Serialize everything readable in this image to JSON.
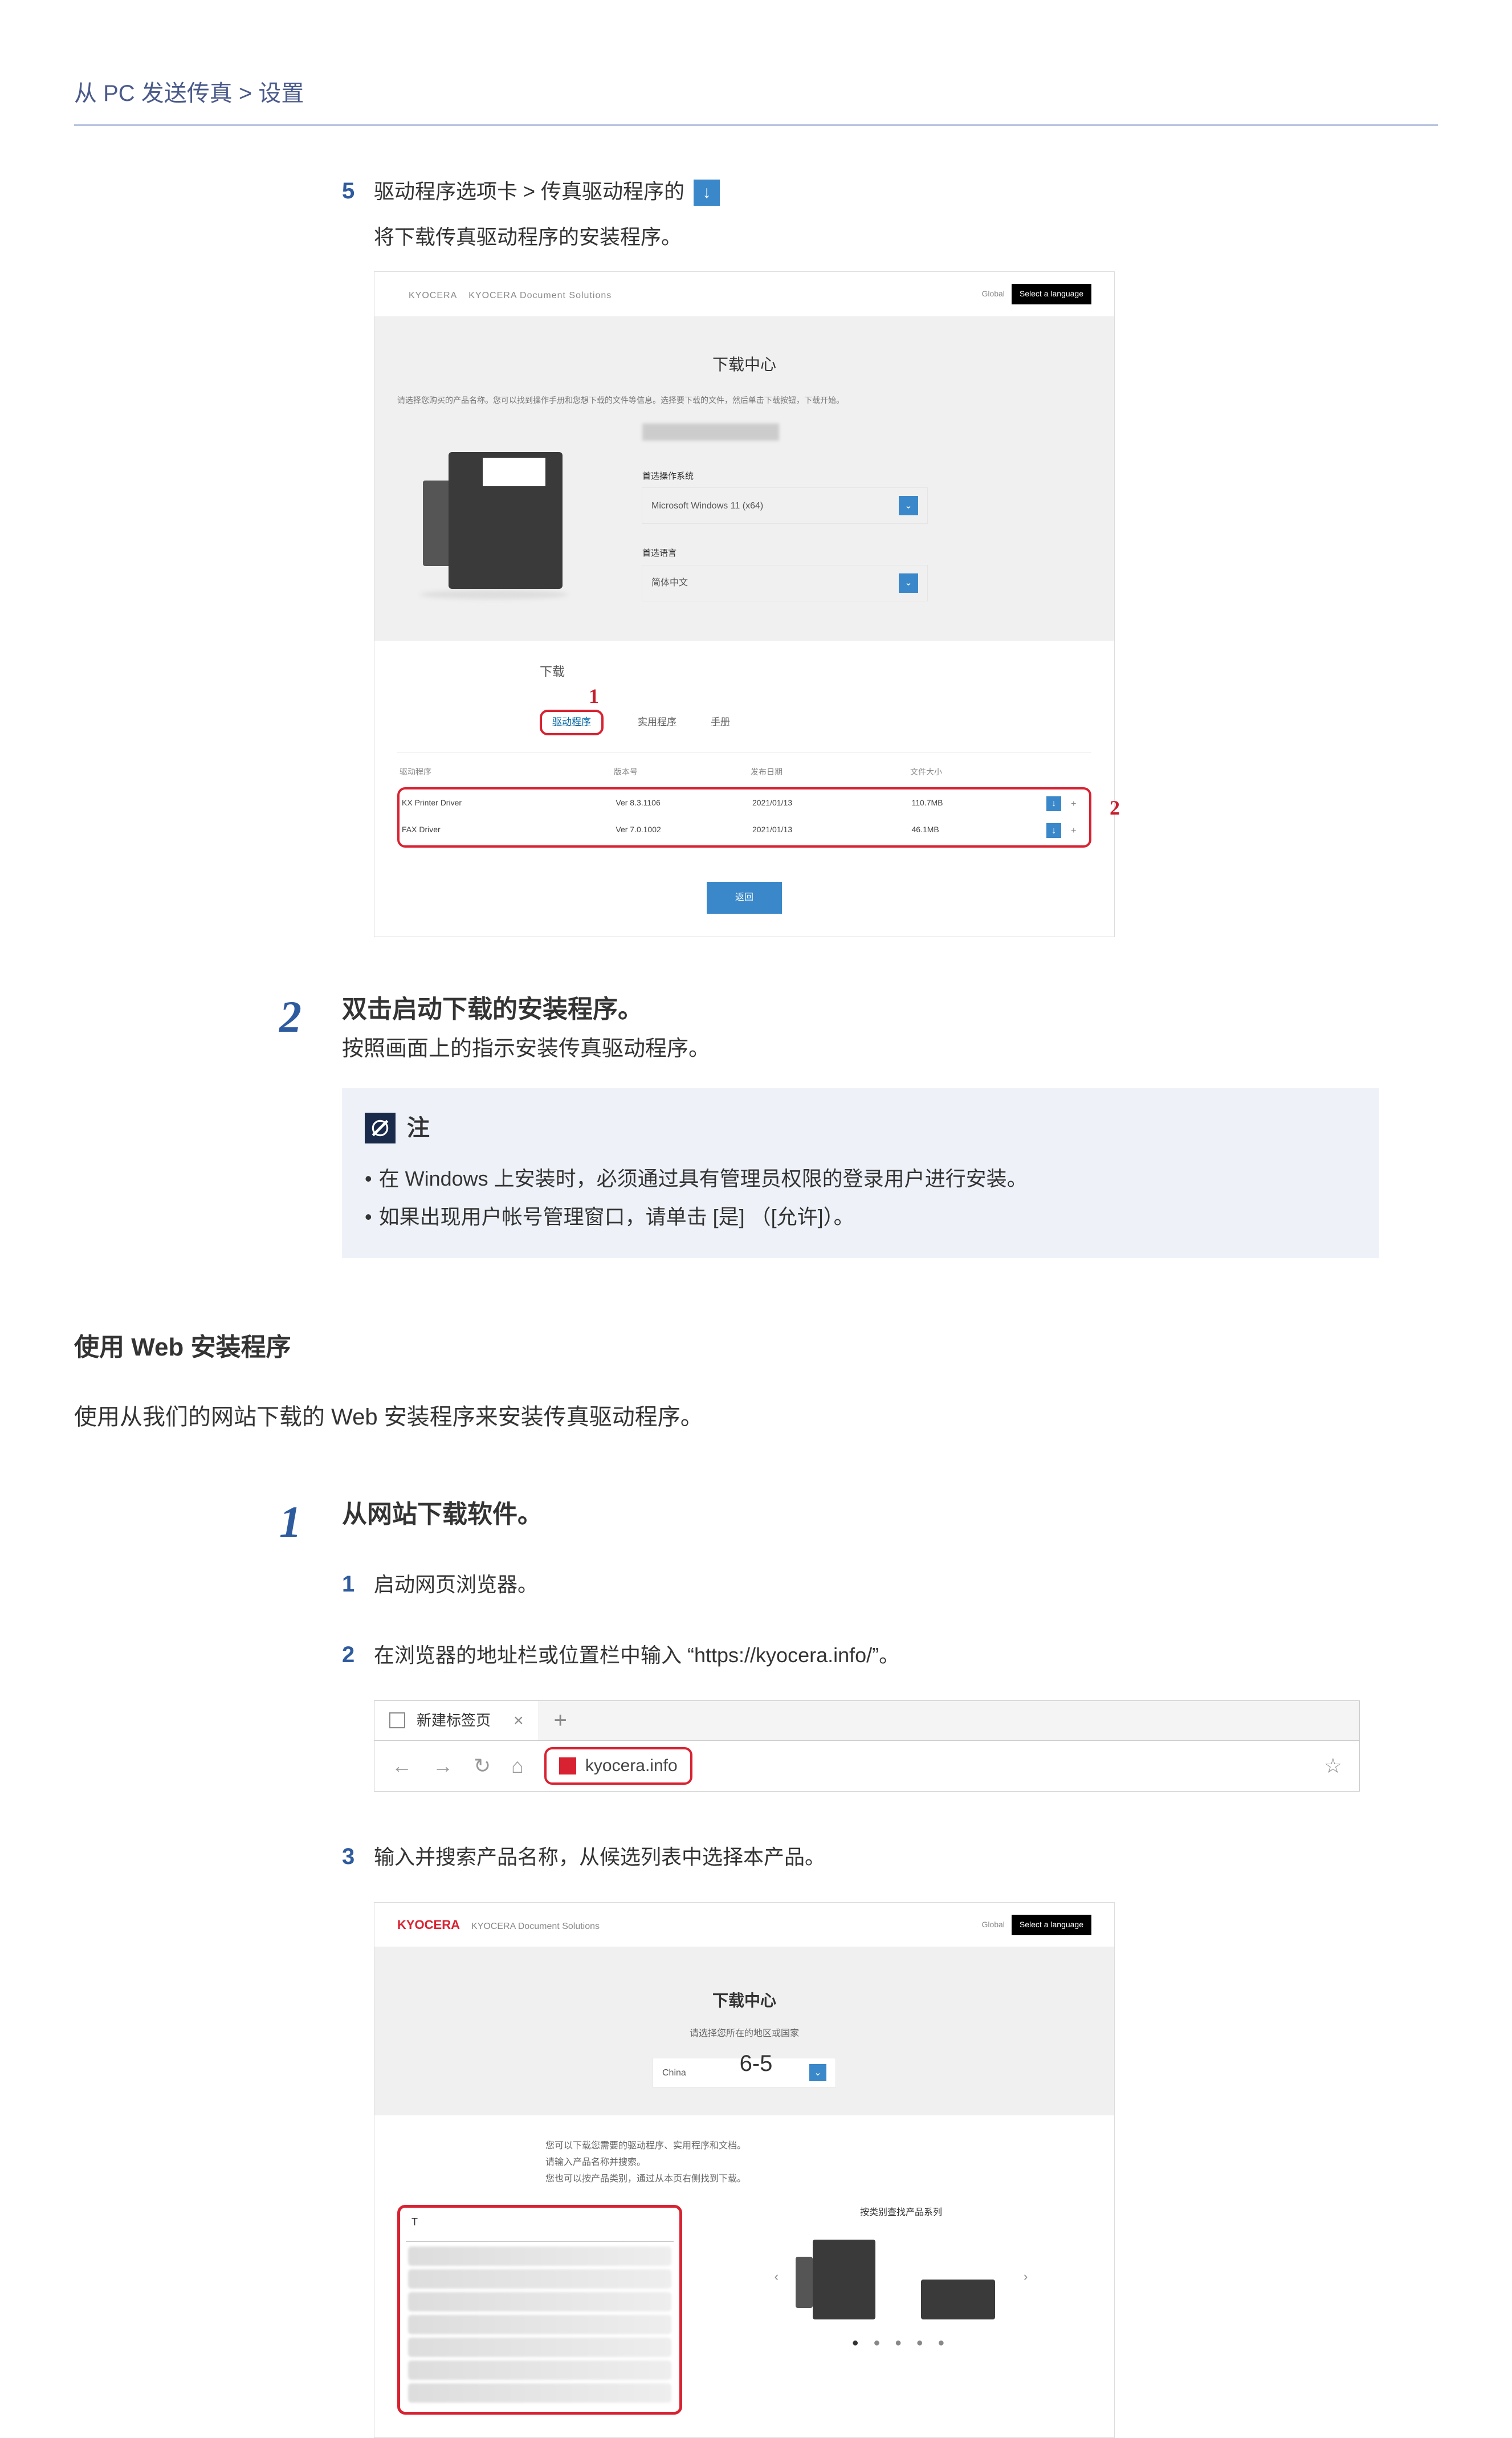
{
  "breadcrumb": "从 PC 发送传真 > 设置",
  "step5": {
    "num": "5",
    "line1_pre": "驱动程序选项卡 > 传真驱动程序的",
    "line2": "将下载传真驱动程序的安装程序。"
  },
  "dlCenter1": {
    "logo_brand": "KYOCERA",
    "logo_sub": "KYOCERA Document Solutions",
    "global": "Global",
    "lang": "Select a language",
    "title": "下载中心",
    "desc": "请选择您购买的产品名称。您可以找到操作手册和您想下载的文件等信息。选择要下载的文件，然后单击下载按钮，下载开始。",
    "osLabel": "首选操作系统",
    "osValue": "Microsoft Windows 11 (x64)",
    "langLabel": "首选语言",
    "langValue": "简体中文",
    "dlTitle": "下载",
    "tabActive": "驱动程序",
    "tab2": "实用程序",
    "tab3": "手册",
    "cols": {
      "name": "驱动程序",
      "ver": "版本号",
      "date": "发布日期",
      "size": "文件大小"
    },
    "rows": [
      {
        "name": "KX Printer Driver",
        "ver": "Ver 8.3.1106",
        "date": "2021/01/13",
        "size": "110.7MB"
      },
      {
        "name": "FAX Driver",
        "ver": "Ver 7.0.1002",
        "date": "2021/01/13",
        "size": "46.1MB"
      }
    ],
    "returnBtn": "返回",
    "callout1": "1",
    "callout2": "2"
  },
  "bigstep2": {
    "num": "2",
    "title": "双击启动下载的安装程序。",
    "desc": "按照画面上的指示安装传真驱动程序。"
  },
  "note": {
    "title": "注",
    "items": [
      "在 Windows 上安装时，必须通过具有管理员权限的登录用户进行安装。",
      "如果出现用户帐号管理窗口，请单击 [是] （[允许]）。"
    ]
  },
  "sect": {
    "heading": "使用 Web 安装程序",
    "intro": "使用从我们的网站下载的 Web 安装程序来安装传真驱动程序。"
  },
  "bigstep1b": {
    "num": "1",
    "title": "从网站下载软件。"
  },
  "sub1": {
    "num": "1",
    "text": "启动网页浏览器。"
  },
  "sub2": {
    "num": "2",
    "text": "在浏览器的地址栏或位置栏中输入 “https://kyocera.info/”。"
  },
  "browser": {
    "tabName": "新建标签页",
    "url": "kyocera.info"
  },
  "sub3": {
    "num": "3",
    "text": "输入并搜索产品名称，从候选列表中选择本产品。"
  },
  "dlCenter3": {
    "logo_brand": "KYOCERA",
    "logo_sub": "KYOCERA Document Solutions",
    "global": "Global",
    "lang": "Select a language",
    "title": "下载中心",
    "subtitle": "请选择您所在的地区或国家",
    "region": "China",
    "info1": "您可以下载您需要的驱动程序、实用程序和文档。",
    "info2": "请输入产品名称并搜索。",
    "info3": "您也可以按产品类别，通过从本页右侧找到下载。",
    "searchInput": "T",
    "rightTitle": "按类别查找产品系列"
  },
  "pageNum": "6-5"
}
